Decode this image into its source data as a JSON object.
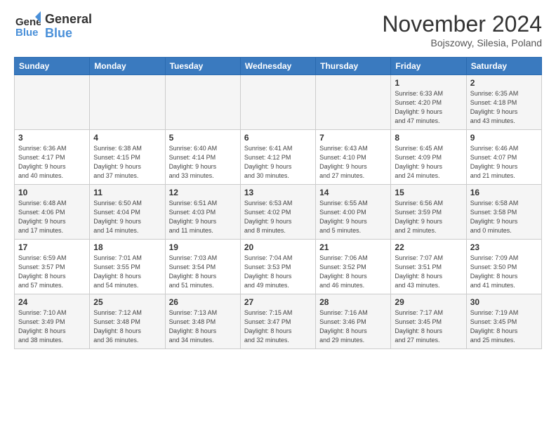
{
  "header": {
    "logo_line1": "General",
    "logo_line2": "Blue",
    "month": "November 2024",
    "location": "Bojszowy, Silesia, Poland"
  },
  "weekdays": [
    "Sunday",
    "Monday",
    "Tuesday",
    "Wednesday",
    "Thursday",
    "Friday",
    "Saturday"
  ],
  "weeks": [
    [
      {
        "day": "",
        "info": ""
      },
      {
        "day": "",
        "info": ""
      },
      {
        "day": "",
        "info": ""
      },
      {
        "day": "",
        "info": ""
      },
      {
        "day": "",
        "info": ""
      },
      {
        "day": "1",
        "info": "Sunrise: 6:33 AM\nSunset: 4:20 PM\nDaylight: 9 hours\nand 47 minutes."
      },
      {
        "day": "2",
        "info": "Sunrise: 6:35 AM\nSunset: 4:18 PM\nDaylight: 9 hours\nand 43 minutes."
      }
    ],
    [
      {
        "day": "3",
        "info": "Sunrise: 6:36 AM\nSunset: 4:17 PM\nDaylight: 9 hours\nand 40 minutes."
      },
      {
        "day": "4",
        "info": "Sunrise: 6:38 AM\nSunset: 4:15 PM\nDaylight: 9 hours\nand 37 minutes."
      },
      {
        "day": "5",
        "info": "Sunrise: 6:40 AM\nSunset: 4:14 PM\nDaylight: 9 hours\nand 33 minutes."
      },
      {
        "day": "6",
        "info": "Sunrise: 6:41 AM\nSunset: 4:12 PM\nDaylight: 9 hours\nand 30 minutes."
      },
      {
        "day": "7",
        "info": "Sunrise: 6:43 AM\nSunset: 4:10 PM\nDaylight: 9 hours\nand 27 minutes."
      },
      {
        "day": "8",
        "info": "Sunrise: 6:45 AM\nSunset: 4:09 PM\nDaylight: 9 hours\nand 24 minutes."
      },
      {
        "day": "9",
        "info": "Sunrise: 6:46 AM\nSunset: 4:07 PM\nDaylight: 9 hours\nand 21 minutes."
      }
    ],
    [
      {
        "day": "10",
        "info": "Sunrise: 6:48 AM\nSunset: 4:06 PM\nDaylight: 9 hours\nand 17 minutes."
      },
      {
        "day": "11",
        "info": "Sunrise: 6:50 AM\nSunset: 4:04 PM\nDaylight: 9 hours\nand 14 minutes."
      },
      {
        "day": "12",
        "info": "Sunrise: 6:51 AM\nSunset: 4:03 PM\nDaylight: 9 hours\nand 11 minutes."
      },
      {
        "day": "13",
        "info": "Sunrise: 6:53 AM\nSunset: 4:02 PM\nDaylight: 9 hours\nand 8 minutes."
      },
      {
        "day": "14",
        "info": "Sunrise: 6:55 AM\nSunset: 4:00 PM\nDaylight: 9 hours\nand 5 minutes."
      },
      {
        "day": "15",
        "info": "Sunrise: 6:56 AM\nSunset: 3:59 PM\nDaylight: 9 hours\nand 2 minutes."
      },
      {
        "day": "16",
        "info": "Sunrise: 6:58 AM\nSunset: 3:58 PM\nDaylight: 9 hours\nand 0 minutes."
      }
    ],
    [
      {
        "day": "17",
        "info": "Sunrise: 6:59 AM\nSunset: 3:57 PM\nDaylight: 8 hours\nand 57 minutes."
      },
      {
        "day": "18",
        "info": "Sunrise: 7:01 AM\nSunset: 3:55 PM\nDaylight: 8 hours\nand 54 minutes."
      },
      {
        "day": "19",
        "info": "Sunrise: 7:03 AM\nSunset: 3:54 PM\nDaylight: 8 hours\nand 51 minutes."
      },
      {
        "day": "20",
        "info": "Sunrise: 7:04 AM\nSunset: 3:53 PM\nDaylight: 8 hours\nand 49 minutes."
      },
      {
        "day": "21",
        "info": "Sunrise: 7:06 AM\nSunset: 3:52 PM\nDaylight: 8 hours\nand 46 minutes."
      },
      {
        "day": "22",
        "info": "Sunrise: 7:07 AM\nSunset: 3:51 PM\nDaylight: 8 hours\nand 43 minutes."
      },
      {
        "day": "23",
        "info": "Sunrise: 7:09 AM\nSunset: 3:50 PM\nDaylight: 8 hours\nand 41 minutes."
      }
    ],
    [
      {
        "day": "24",
        "info": "Sunrise: 7:10 AM\nSunset: 3:49 PM\nDaylight: 8 hours\nand 38 minutes."
      },
      {
        "day": "25",
        "info": "Sunrise: 7:12 AM\nSunset: 3:48 PM\nDaylight: 8 hours\nand 36 minutes."
      },
      {
        "day": "26",
        "info": "Sunrise: 7:13 AM\nSunset: 3:48 PM\nDaylight: 8 hours\nand 34 minutes."
      },
      {
        "day": "27",
        "info": "Sunrise: 7:15 AM\nSunset: 3:47 PM\nDaylight: 8 hours\nand 32 minutes."
      },
      {
        "day": "28",
        "info": "Sunrise: 7:16 AM\nSunset: 3:46 PM\nDaylight: 8 hours\nand 29 minutes."
      },
      {
        "day": "29",
        "info": "Sunrise: 7:17 AM\nSunset: 3:45 PM\nDaylight: 8 hours\nand 27 minutes."
      },
      {
        "day": "30",
        "info": "Sunrise: 7:19 AM\nSunset: 3:45 PM\nDaylight: 8 hours\nand 25 minutes."
      }
    ]
  ]
}
